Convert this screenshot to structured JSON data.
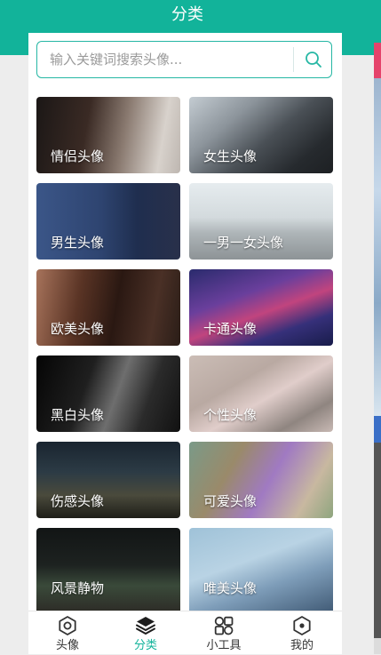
{
  "header": {
    "title": "分类"
  },
  "search": {
    "placeholder": "输入关键词搜索头像...",
    "value": ""
  },
  "categories": [
    {
      "label": "情侣头像"
    },
    {
      "label": "女生头像"
    },
    {
      "label": "男生头像"
    },
    {
      "label": "一男一女头像"
    },
    {
      "label": "欧美头像"
    },
    {
      "label": "卡通头像"
    },
    {
      "label": "黑白头像"
    },
    {
      "label": "个性头像"
    },
    {
      "label": "伤感头像"
    },
    {
      "label": "可爱头像"
    },
    {
      "label": "风景静物"
    },
    {
      "label": "唯美头像"
    }
  ],
  "tabbar": {
    "tabs": [
      {
        "label": "头像",
        "icon": "camera-icon",
        "active": false
      },
      {
        "label": "分类",
        "icon": "layers-icon",
        "active": true
      },
      {
        "label": "小工具",
        "icon": "tools-icon",
        "active": false
      },
      {
        "label": "我的",
        "icon": "profile-icon",
        "active": false
      }
    ]
  },
  "colors": {
    "accent": "#12b39a",
    "search_border": "#26b7a4",
    "background": "#ededed"
  }
}
